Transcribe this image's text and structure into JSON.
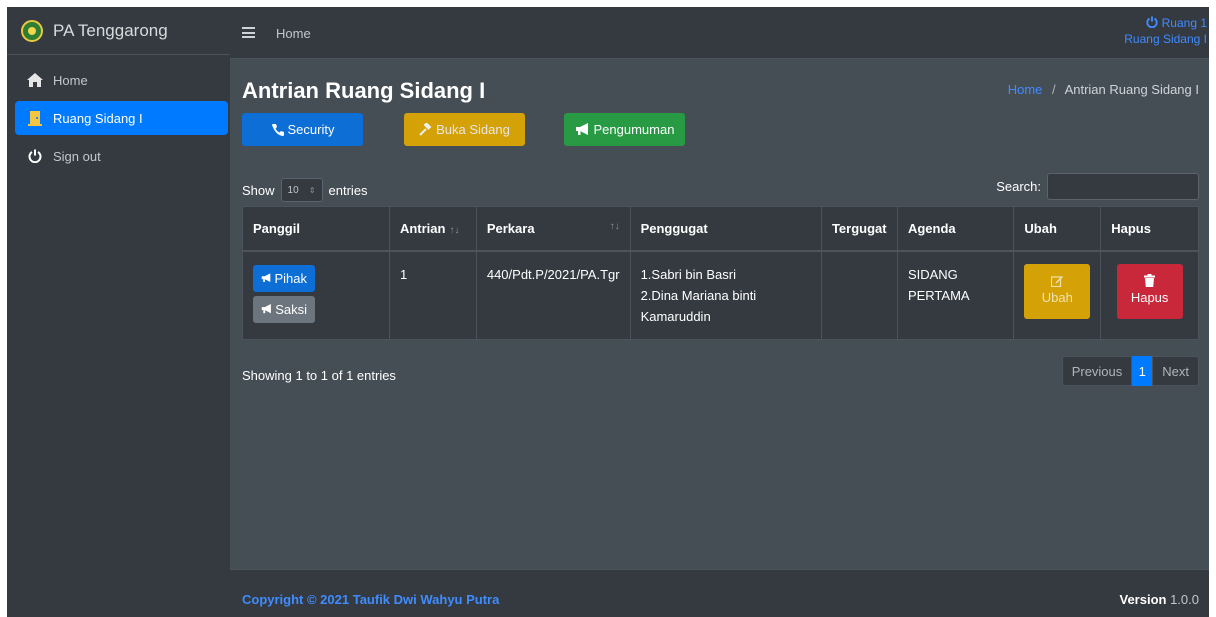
{
  "brand": {
    "name": "PA Tenggarong"
  },
  "sidebar": {
    "items": [
      {
        "label": "Home",
        "icon": "home-icon"
      },
      {
        "label": "Ruang Sidang I",
        "icon": "door-icon"
      },
      {
        "label": "Sign out",
        "icon": "power-icon"
      }
    ]
  },
  "topbar": {
    "home_label": "Home",
    "user_line1": "Ruang 1",
    "user_line2": "Ruang Sidang I"
  },
  "page": {
    "title": "Antrian Ruang Sidang I",
    "breadcrumb_home": "Home",
    "breadcrumb_sep": "/",
    "breadcrumb_current": "Antrian Ruang Sidang I"
  },
  "actions": {
    "security": "Security",
    "buka_sidang": "Buka Sidang",
    "pengumuman": "Pengumuman"
  },
  "table_controls": {
    "show_label": "Show",
    "entries_value": "10",
    "entries_label": "entries",
    "search_label": "Search:",
    "search_value": ""
  },
  "table": {
    "headers": [
      "Panggil",
      "Antrian",
      "Perkara",
      "Penggugat",
      "Tergugat",
      "Agenda",
      "Ubah",
      "Hapus"
    ],
    "rows": [
      {
        "pihak_label": "Pihak",
        "saksi_label": "Saksi",
        "antrian": "1",
        "perkara": "440/Pdt.P/2021/PA.Tgr",
        "penggugat_1": "1.Sabri bin Basri",
        "penggugat_2": "2.Dina Mariana binti Kamaruddin",
        "tergugat": "",
        "agenda": "SIDANG PERTAMA",
        "ubah_label": "Ubah",
        "hapus_label": "Hapus"
      }
    ]
  },
  "pagination": {
    "info": "Showing 1 to 1 of 1 entries",
    "previous": "Previous",
    "current": "1",
    "next": "Next"
  },
  "footer": {
    "copyright": "Copyright © 2021 Taufik Dwi Wahyu Putra",
    "version_label": "Version",
    "version_value": "1.0.0"
  },
  "colors": {
    "primary": "#007bff",
    "warning": "#d4a106",
    "success": "#289a43",
    "danger": "#c9283a",
    "secondary": "#6c757d",
    "dark_bg": "#343a40",
    "content_bg": "#454d55"
  }
}
